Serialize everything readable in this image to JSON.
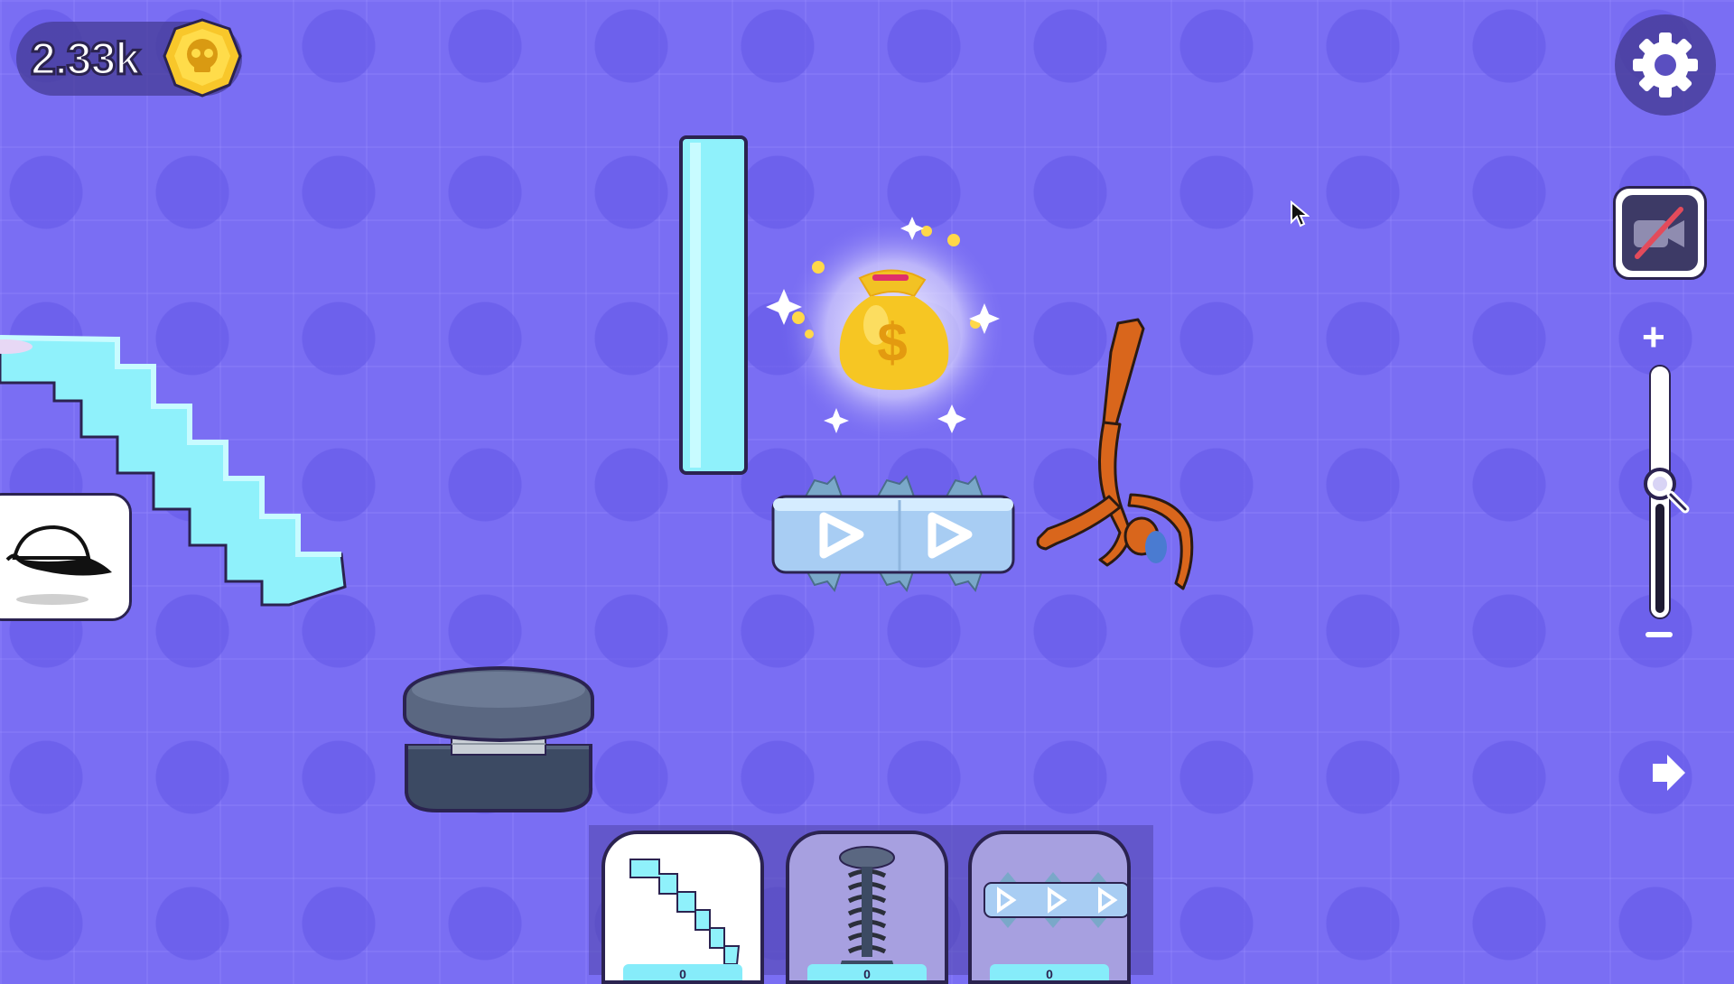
{
  "hud": {
    "coins": "2.33k",
    "coin_icon": "skull-coin-icon",
    "settings_icon": "gear-icon",
    "camera_icon": "camera-off-icon",
    "zoom_in_label": "+",
    "zoom_level": 0.45,
    "next_icon": "arrow-right-icon"
  },
  "toolbar": {
    "slots": [
      {
        "name": "stairs",
        "count": "0",
        "selected": true
      },
      {
        "name": "spring",
        "count": "0",
        "selected": false
      },
      {
        "name": "conveyor",
        "count": "0",
        "selected": false
      }
    ]
  },
  "scene": {
    "objects": [
      "stairs",
      "vertical-bar",
      "money-bag",
      "spiked-conveyor",
      "ragdoll",
      "trampoline-spring"
    ],
    "hat_icon": "cap-icon"
  },
  "colors": {
    "background": "#7a6ef3",
    "ice": "#8ff1fb",
    "gold": "#f6c623",
    "ragdoll": "#d9661c",
    "outline": "#2b2350"
  }
}
